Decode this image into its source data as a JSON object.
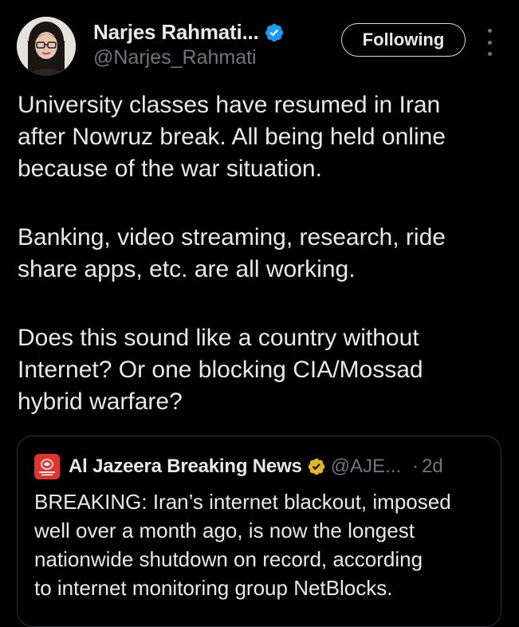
{
  "author": {
    "name": "Narjes Rahmati...",
    "handle": "@Narjes_Rahmati",
    "verified": true,
    "avatar_icon": "profile-photo-woman-glasses"
  },
  "follow_button": {
    "label": "Following"
  },
  "more_button": {
    "icon": "more-vertical-icon"
  },
  "tweet": {
    "paragraphs": [
      [
        "University classes have resumed in Iran",
        "after Nowruz break. All being held online",
        "because of the war situation."
      ],
      [
        "Banking, video streaming, research, ride",
        "share apps, etc. are all working."
      ],
      [
        "Does this sound like a country without",
        "Internet? Or one blocking CIA/Mossad",
        "hybrid warfare?"
      ]
    ]
  },
  "quote": {
    "name": "Al Jazeera Breaking News",
    "handle": "@AJE...",
    "separator": "·",
    "time": "2d",
    "verified_type": "gold",
    "avatar_icon": "aljazeera-logo",
    "text_lines": [
      "BREAKING: Iran’s internet blackout, imposed",
      "well over a month ago, is now the longest",
      "nationwide shutdown on record, according",
      "to internet monitoring group NetBlocks."
    ]
  },
  "colors": {
    "background": "#000000",
    "primary_text": "#e7e9ea",
    "secondary_text": "#71767b",
    "verified_blue": "#1d9bf0",
    "verified_gold": "#e2b719",
    "border": "#2f3336"
  }
}
